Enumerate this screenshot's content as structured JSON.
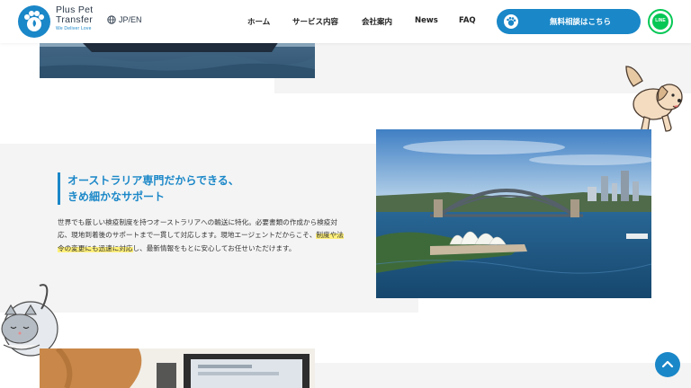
{
  "header": {
    "brand_line1": "Plus Pet",
    "brand_line2": "Transfer",
    "tagline": "We Deliver Love",
    "language": "JP/EN",
    "nav": [
      "ホーム",
      "サービス内容",
      "会社案内",
      "News",
      "FAQ"
    ],
    "cta_label": "無料相談はこちら",
    "line_label": "LINE"
  },
  "section": {
    "heading_line1": "オーストラリア専門だからできる、",
    "heading_line2": "きめ細かなサポート",
    "body_before": "世界でも厳しい検疫制度を持つオーストラリアへの輸送に特化。必要書類の作成から検疫対応、現地到着後のサポートまで一貫して対応します。現地エージェントだからこそ、",
    "body_highlight": "制度や法令の変更にも迅速に対応",
    "body_after": "し、最新情報をもとに安心してお任せいただけます。"
  },
  "colors": {
    "accent": "#1a87c8",
    "line_green": "#06c755",
    "highlight": "#fff07a"
  },
  "icons": {
    "logo": "paw-logo-icon",
    "language": "globe-icon",
    "cta": "paw-icon",
    "scroll_top": "chevron-up-icon"
  }
}
